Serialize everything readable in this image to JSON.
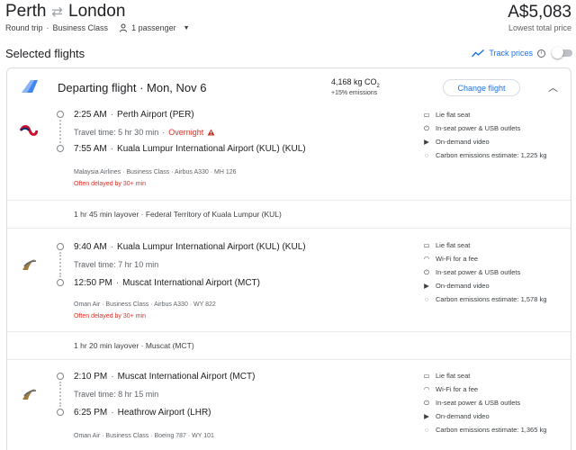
{
  "header": {
    "origin": "Perth",
    "destination": "London",
    "trip_type": "Round trip",
    "cabin": "Business Class",
    "passengers": "1 passenger",
    "price": "A$5,083",
    "price_note": "Lowest total price"
  },
  "selected_title": "Selected flights",
  "track_prices_label": "Track prices",
  "departing": {
    "title": "Departing flight",
    "date": "Mon, Nov 6",
    "co2_value": "4,168 kg CO",
    "co2_sub": "2",
    "co2_note": "+15% emissions",
    "change_label": "Change flight"
  },
  "segments": [
    {
      "dep_time": "2:25 AM",
      "dep_airport": "Perth Airport (PER)",
      "travel_time": "Travel time: 5 hr 30 min",
      "overnight": "Overnight",
      "arr_time": "7:55 AM",
      "arr_airport": "Kuala Lumpur International Airport (KUL) (KUL)",
      "details": "Malaysia Airlines · Business Class · Airbus A330 · MH 126",
      "delayed": "Often delayed by 30+ min",
      "amenities": [
        "Lie flat seat",
        "In-seat power & USB outlets",
        "On-demand video",
        "Carbon emissions estimate: 1,225 kg"
      ]
    },
    {
      "dep_time": "9:40 AM",
      "dep_airport": "Kuala Lumpur International Airport (KUL) (KUL)",
      "travel_time": "Travel time: 7 hr 10 min",
      "arr_time": "12:50 PM",
      "arr_airport": "Muscat International Airport (MCT)",
      "details": "Oman Air · Business Class · Airbus A330 · WY 822",
      "delayed": "Often delayed by 30+ min",
      "amenities": [
        "Lie flat seat",
        "Wi-Fi for a fee",
        "In-seat power & USB outlets",
        "On-demand video",
        "Carbon emissions estimate: 1,578 kg"
      ]
    },
    {
      "dep_time": "2:10 PM",
      "dep_airport": "Muscat International Airport (MCT)",
      "travel_time": "Travel time: 8 hr 15 min",
      "arr_time": "6:25 PM",
      "arr_airport": "Heathrow Airport (LHR)",
      "details": "Oman Air · Business Class · Boeing 787 · WY 101",
      "amenities": [
        "Lie flat seat",
        "Wi-Fi for a fee",
        "In-seat power & USB outlets",
        "On-demand video",
        "Carbon emissions estimate: 1,365 kg"
      ]
    }
  ],
  "layovers": [
    "1 hr 45 min layover · Federal Territory of Kuala Lumpur (KUL)",
    "1 hr 20 min layover · Muscat (MCT)"
  ],
  "colors": {
    "accent": "#1a73e8",
    "warning": "#d93025",
    "border": "#dadce0"
  }
}
